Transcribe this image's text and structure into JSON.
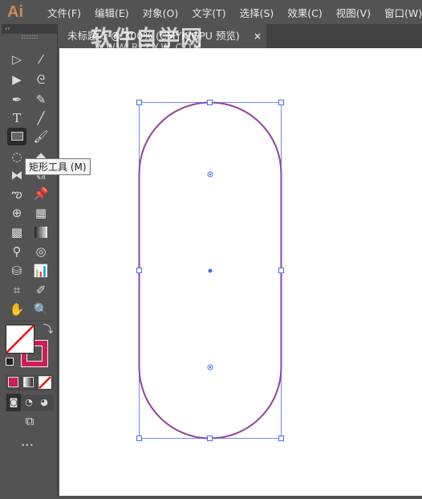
{
  "app": {
    "logo": "Ai"
  },
  "menu": [
    "文件(F)",
    "编辑(E)",
    "对象(O)",
    "文字(T)",
    "选择(S)",
    "效果(C)",
    "视图(V)",
    "窗口(W)"
  ],
  "toolbar": {
    "collapse": "‹‹",
    "tooltip": "矩形工具 (M)",
    "more": "•••"
  },
  "document_tab": {
    "title": "未标题-1 @ 300% (CMYK/GPU 预览)",
    "close": "×"
  },
  "watermark": {
    "title": "软件自学网",
    "url": "WWW.RJZXW.COM"
  },
  "colors": {
    "fill": "none",
    "stroke": "#cc1f56",
    "selection": "#4a6cf0"
  }
}
